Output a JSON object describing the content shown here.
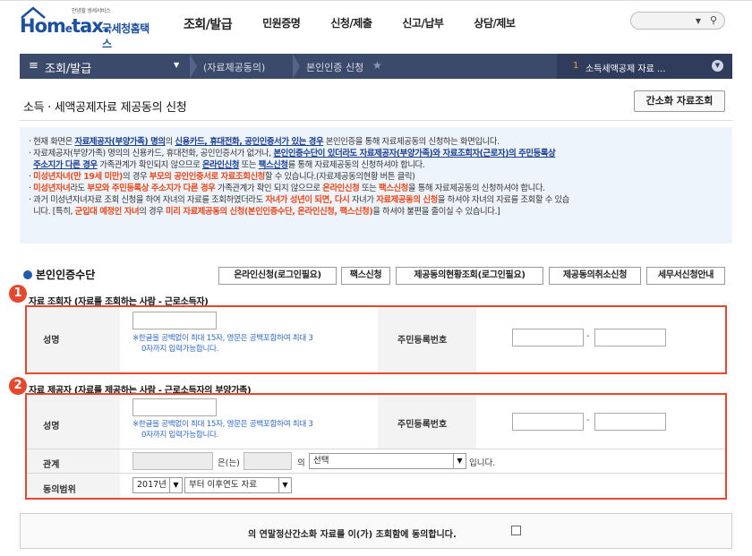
{
  "header": {
    "logo_sub": "안녕할 생세서비스",
    "logo_main": "Hom",
    "logo_e": "e",
    "logo_tax": "tax.",
    "logo_kor": "국세청홈택스",
    "menu": [
      "조회/발급",
      "민원증명",
      "신청/제출",
      "신고/납부",
      "상담/제보"
    ],
    "search_dropdown_icon": "chevron-down-icon",
    "search_icon": "search-icon"
  },
  "navbar": {
    "menu_label": "조회/발급",
    "breadcrumb1": "(자료제공동의)",
    "breadcrumb2": "본인인증 신청",
    "recent_num": "1",
    "recent_text": "소득세액공제 자료 ..."
  },
  "page": {
    "title": "소득 · 세액공제자료 제공동의 신청",
    "simple_button": "간소화 자료조회"
  },
  "notice": {
    "l1a": "현재 화면은 ",
    "l1b": "자료제공자(부양가족) 명의",
    "l1c": "의 ",
    "l1d": "신용카드, 휴대전화, 공인인증서가 있는 경우",
    "l1e": " 본인인증을 통해 자료제공동의 신청하는 화면입니다.",
    "l2a": "자료제공자(부양가족) 명의의 신용카드, 휴대전화, 공인인증서가 없거나, ",
    "l2b": "본인인증수단이 있더라도 자료제공자(부양가족)와 자료조회자(근로자)의 주민등록상",
    "l3a": "주소지가 다른 경우",
    "l3b": " 가족관계가 확인되지 않으므로 ",
    "l3c": "온라인신청",
    "l3d": " 또는 ",
    "l3e": "팩스신청",
    "l3f": "를 통해 자료제공동의 신청하셔야 합니다.",
    "l4a": "미성년자녀(만 19세 미만)",
    "l4b": "의 경우 ",
    "l4c": "부모의 공인인증서로 자료조회신청",
    "l4d": "할 수 있습니다.(자료제공동의현황 버튼 클릭)",
    "l5a": "미성년자녀",
    "l5b": "라도 ",
    "l5c": "부모와 주민등록상 주소지가 다른 경우",
    "l5d": " 가족관계가 확인 되지 않으므로 ",
    "l5e": "온라인신청",
    "l5f": " 또는 ",
    "l5g": "팩스신청",
    "l5h": "을 통해 자료제공동의 신청하셔야 합니다.",
    "l6a": "과거 미성년자녀자료 조회 신청을 하여 자녀의 자료를 조회하였더라도 ",
    "l6b": "자녀가 성년이 되면, 다시",
    "l6c": " 자녀가 ",
    "l6d": "자료제공동의 신청",
    "l6e": "을 하셔야 자녀의 자료를 조회할 수 있습",
    "l7a": "니다. [특히, ",
    "l7b": "군입대 예정인 자녀",
    "l7c": "의 경우 ",
    "l7d": "미리 자료제공동의 신청(본인인증수단, 온라인신청, 팩스신청)",
    "l7e": "을 하셔야 불편을 줄이실 수 있습니다.]"
  },
  "auth": {
    "heading": "본인인증수단",
    "buttons": [
      "온라인신청(로그인필요)",
      "팩스신청",
      "제공동의현황조회(로그인필요)",
      "제공동의취소신청",
      "세무서신청안내"
    ]
  },
  "viewer": {
    "badge": "1",
    "title": "자료 조회자 (자료를 조회하는 사람 - 근로소득자)",
    "name_label": "성명",
    "name_value": "",
    "hint1": "※한글을 공백없이 최대 15자, 영문은 공백포함하여 최대 3",
    "hint2": "0자까지 입력가능합니다.",
    "rrn_label": "주민등록번호",
    "rrn_sep": "-",
    "rrn1": "",
    "rrn2": ""
  },
  "provider": {
    "badge": "2",
    "title": "자료 제공자 (자료를 제공하는 사람 - 근로소득자의 부양가족)",
    "name_label": "성명",
    "name_value": "",
    "hint1": "※한글을 공백없이 최대 15자, 영문은 공백포함하여 최대 3",
    "hint2": "0자까지 입력가능합니다.",
    "rrn_label": "주민등록번호",
    "rrn_sep": "-",
    "rrn1": "",
    "rrn2": "",
    "relation_label": "관계",
    "relation_mid": "은(는)",
    "relation_of": "의",
    "relation_select": "선택",
    "relation_end": "입니다.",
    "range_label": "동의범위",
    "year_select": "2017년",
    "range_select": "부터 이후연도 자료"
  },
  "agree": {
    "text": "의 연말정산간소화 자료를 이(가) 조회함에 동의합니다.",
    "checked": false
  },
  "colors": {
    "navy": "#3b4a6b",
    "brand_blue": "#1b4fa0",
    "highlight_red": "#e8491d",
    "badge_red": "#e5482c",
    "notice_bg": "#eef4fb"
  }
}
